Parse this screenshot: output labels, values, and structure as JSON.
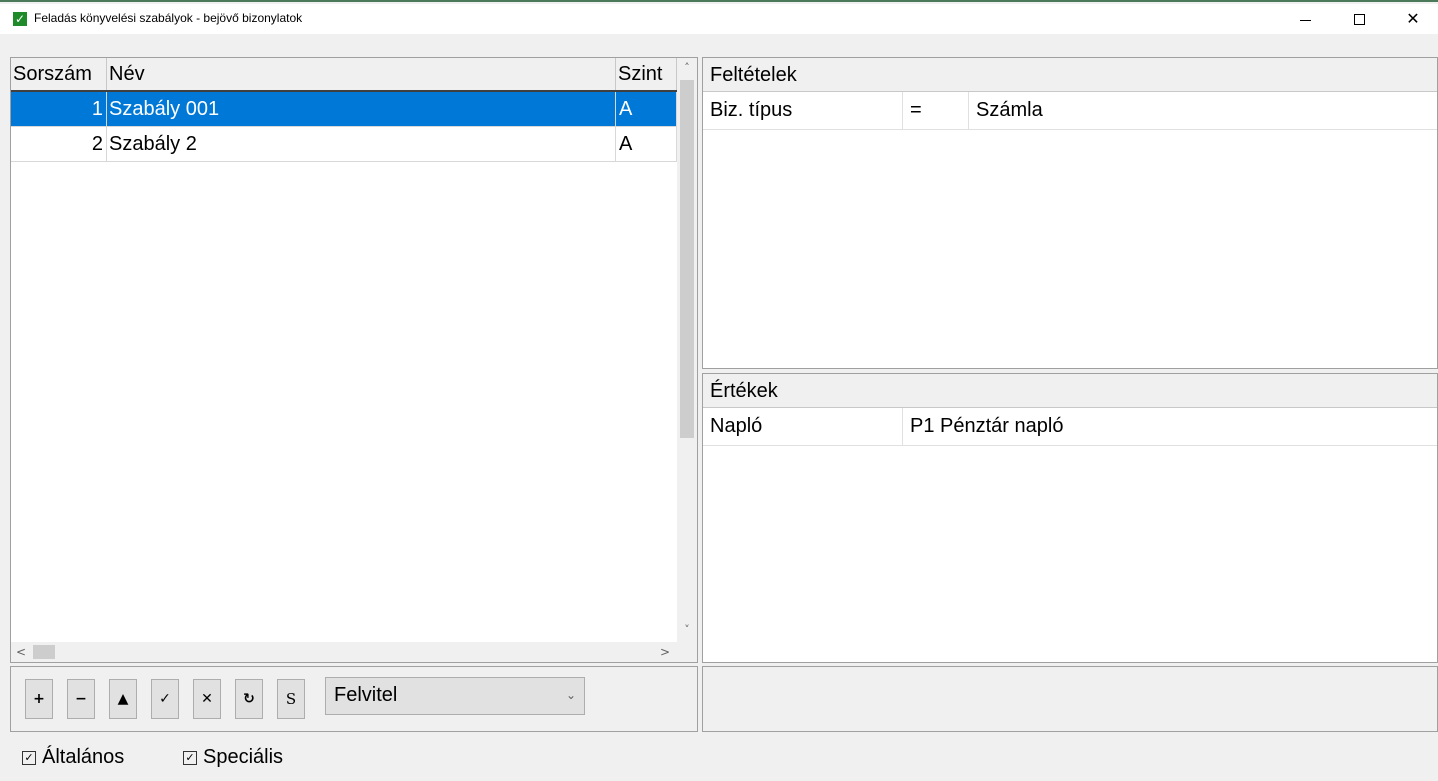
{
  "window": {
    "title": "Feladás könyvelési szabályok - bejövő bizonylatok",
    "icon": "checkmark-icon",
    "app_icon_glyph": "✓",
    "close_glyph": "✕"
  },
  "rules_grid": {
    "columns": [
      "Sorszám",
      "Név",
      "Szint"
    ],
    "rows": [
      {
        "num": "1",
        "name": "Szabály 001",
        "level": "A",
        "selected": true
      },
      {
        "num": "2",
        "name": "Szabály 2",
        "level": "A",
        "selected": false
      }
    ],
    "scroll_up_glyph": "˄",
    "scroll_down_glyph": "˅",
    "scroll_left_glyph": "<",
    "scroll_right_glyph": ">"
  },
  "conditions": {
    "header": "Feltételek",
    "rows": [
      {
        "field": "Biz. típus",
        "operator": "=",
        "value": "Számla"
      }
    ]
  },
  "values": {
    "header": "Értékek",
    "rows": [
      {
        "field": "Napló",
        "value": "P1 Pénztár napló"
      }
    ]
  },
  "toolbar": {
    "add": "+",
    "remove": "−",
    "move_up": "▲",
    "confirm": "✓",
    "cancel": "✕",
    "refresh": "↻",
    "s": "S",
    "mode_select": "Felvitel",
    "dropdown_glyph": "⌄"
  },
  "filters": {
    "general": {
      "label": "Általános",
      "checked": true,
      "glyph": "✓"
    },
    "special": {
      "label": "Speciális",
      "checked": true,
      "glyph": "✓"
    }
  },
  "colors": {
    "selection": "#0078d7",
    "app_icon": "#1e8a2a"
  }
}
